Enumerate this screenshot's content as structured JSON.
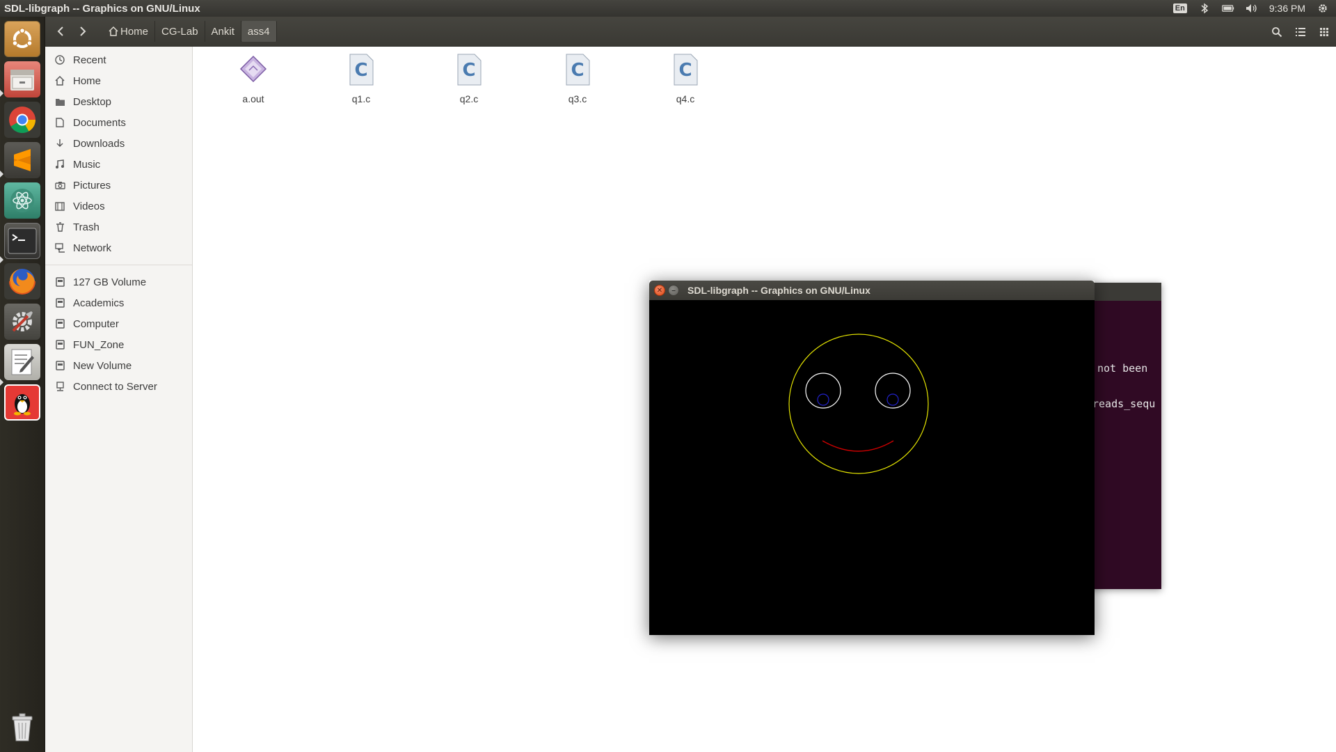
{
  "top_panel": {
    "title": "SDL-libgraph -- Graphics on GNU/Linux",
    "indicators": {
      "keyboard": "En",
      "time": "9:36 PM"
    }
  },
  "launcher": {
    "apps": [
      {
        "name": "dash-home",
        "icon": "ubuntu-logo-icon"
      },
      {
        "name": "files",
        "icon": "file-cabinet-icon"
      },
      {
        "name": "chrome",
        "icon": "chrome-icon"
      },
      {
        "name": "sublime-text",
        "icon": "sublime-icon"
      },
      {
        "name": "atom",
        "icon": "atom-icon"
      },
      {
        "name": "terminal",
        "icon": "terminal-icon"
      },
      {
        "name": "firefox",
        "icon": "firefox-icon"
      },
      {
        "name": "system-settings",
        "icon": "settings-icon"
      },
      {
        "name": "text-editor",
        "icon": "text-editor-icon"
      },
      {
        "name": "linux-app",
        "icon": "tux-icon"
      },
      {
        "name": "trash",
        "icon": "trash-icon"
      }
    ]
  },
  "toolbar": {
    "breadcrumbs": [
      "Home",
      "CG-Lab",
      "Ankit",
      "ass4"
    ]
  },
  "sidebar": {
    "places": [
      {
        "label": "Recent",
        "icon": "clock-icon"
      },
      {
        "label": "Home",
        "icon": "home-icon"
      },
      {
        "label": "Desktop",
        "icon": "folder-icon"
      },
      {
        "label": "Documents",
        "icon": "document-icon"
      },
      {
        "label": "Downloads",
        "icon": "download-icon"
      },
      {
        "label": "Music",
        "icon": "music-icon"
      },
      {
        "label": "Pictures",
        "icon": "camera-icon"
      },
      {
        "label": "Videos",
        "icon": "video-icon"
      },
      {
        "label": "Trash",
        "icon": "trash-icon"
      },
      {
        "label": "Network",
        "icon": "network-icon"
      }
    ],
    "devices": [
      {
        "label": "127 GB Volume",
        "icon": "drive-icon"
      },
      {
        "label": "Academics",
        "icon": "drive-icon"
      },
      {
        "label": "Computer",
        "icon": "drive-icon"
      },
      {
        "label": "FUN_Zone",
        "icon": "drive-icon"
      },
      {
        "label": "New Volume",
        "icon": "drive-icon"
      },
      {
        "label": "Connect to Server",
        "icon": "server-icon"
      }
    ]
  },
  "files": [
    {
      "name": "a.out",
      "type": "executable"
    },
    {
      "name": "q1.c",
      "type": "c-source"
    },
    {
      "name": "q2.c",
      "type": "c-source"
    },
    {
      "name": "q3.c",
      "type": "c-source"
    },
    {
      "name": "q4.c",
      "type": "c-source"
    }
  ],
  "terminal": {
    "visible_lines": [
      "not  been",
      "reads_sequ"
    ]
  },
  "sdl_window": {
    "title": "SDL-libgraph -- Graphics on GNU/Linux",
    "drawing": {
      "face_color": "#e6e600",
      "eye_color": "#ffffff",
      "pupil_color": "#2222cc",
      "mouth_color": "#cc0000",
      "background": "#000000"
    }
  },
  "colors": {
    "panel": "#3c3b37",
    "launcher": "#2a2820",
    "sidebar": "#f5f4f2",
    "terminal_bg": "#300a24"
  }
}
